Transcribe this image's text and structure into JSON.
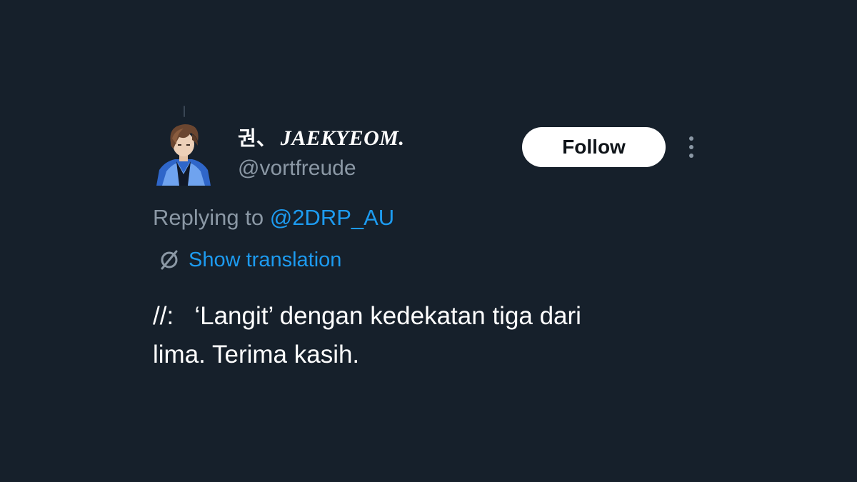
{
  "tweet": {
    "author": {
      "display_name_hangul": "권、",
      "display_name_latin": "JAEKYEOM.",
      "handle": "@vortfreude",
      "avatar": "anime-boy-avatar"
    },
    "follow_label": "Follow",
    "more_icon": "more-vertical-icon",
    "replying_prefix": "Replying to ",
    "replying_mention": "@2DRP_AU",
    "translate_icon": "globe-translate-icon",
    "translate_label": "Show translation",
    "text": "//:   ‘Langit’ dengan kedekatan tiga dari\nlima. Terima kasih."
  },
  "colors": {
    "background": "#16202b",
    "text_primary": "#ffffff",
    "text_secondary": "#8b98a5",
    "accent": "#1d9bf0",
    "button_bg": "#ffffff",
    "button_text": "#0f1419"
  }
}
